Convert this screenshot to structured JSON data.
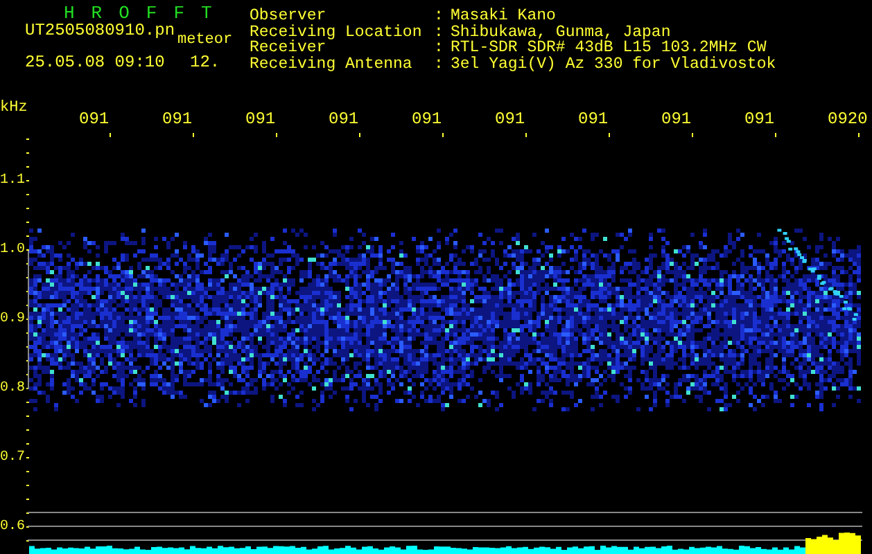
{
  "header": {
    "title": "HROFFT",
    "file_name": "UT2505080910.pn",
    "tag": "meteor",
    "timestamp": "25.05.08 09:10",
    "value": "12."
  },
  "info": [
    {
      "label": "Observer",
      "separator": ":",
      "value": "Masaki Kano"
    },
    {
      "label": "Receiving Location",
      "separator": ":",
      "value": "Shibukawa, Gunma, Japan"
    },
    {
      "label": "Receiver",
      "separator": ":",
      "value": "RTL-SDR SDR# 43dB L15 103.2MHz CW"
    },
    {
      "label": "Receiving Antenna",
      "separator": ":",
      "value": "3el Yagi(V) Az 330 for Vladivostok"
    }
  ],
  "time_axis": {
    "ticks": [
      "091",
      "091",
      "091",
      "091",
      "091",
      "091",
      "091",
      "091",
      "091",
      "0920"
    ]
  },
  "frequency_axis": {
    "unit": "kHz",
    "ticks": [
      "1.1",
      "1.0",
      "0.9",
      "0.8",
      "0.7",
      "0.6"
    ]
  }
}
